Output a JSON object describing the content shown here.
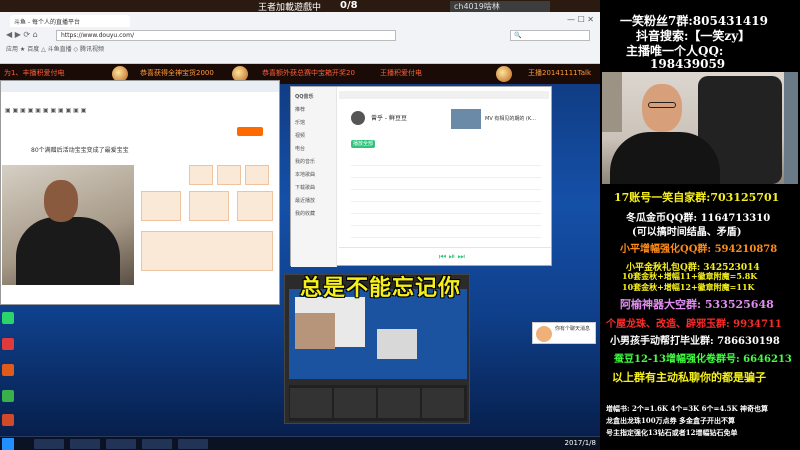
{
  "game_header": {
    "title": "王者加載遊戲中",
    "score": "0/8",
    "tab": "ch4019啥林"
  },
  "browser": {
    "tab_title": "斗鱼 - 每个人的直播平台",
    "url": "https://www.douyu.com/",
    "bookmarks": "应用  ★ 百度  △ 斗鱼直播  ◇ 腾讯视频"
  },
  "promo": {
    "items": [
      "为1、丰播积爱付电",
      "恭喜获得全神宝货2000",
      "恭喜额外获总赛中宝箱开奖20",
      "王播积爱付电",
      "王播20141111Talk"
    ]
  },
  "shop": {
    "title": "80个满赠后活动宝宝变成了最爱宝宝"
  },
  "music": {
    "brand": "QQ音乐",
    "singer": "曾乎 - 鲜豆豆",
    "mv_title": "MV 有相见的期的 (K...",
    "play_all": "播放全部",
    "sidebar": [
      "推荐",
      "乐馆",
      "视频",
      "电台",
      "我的音乐",
      "本地歌曲",
      "下载歌曲",
      "最近播放",
      "我的收藏"
    ]
  },
  "lyric": "总是不能忘记你",
  "notification": "你有个聊天消息",
  "taskbar": {
    "clock": "2017/1/8"
  },
  "info_panel": {
    "line1": "一笑粉丝7群:805431419",
    "line2": "抖音搜索:【一笑zy】",
    "line3": "主播唯一个人QQ:",
    "line4": "198439059",
    "fan17": "17账号一笑自家群:703125701",
    "ice1": "冬瓜金币QQ群: 1164713310",
    "ice2": "(可以搞时间结晶、矛盾)",
    "small": "小平增幅强化QQ群: 594210878",
    "gold1": "小平金秋礼包Q群: 342523014",
    "gold2": "10套金秋+增幅11+徽章附魔=5.8K",
    "gold3": "10套金秋+增幅12+徽章附魔=11K",
    "ayu": "阿榆神器大空群: 533525648",
    "geya": "个屋龙珠、改造、辟邪玉群: 9934711",
    "boy": "小男孩手动帮打毕业群: 786630198",
    "dou": "蚕豆12-13增幅强化卷群号: 6646213",
    "warn": "以上群有主动私聊你的都是骗子",
    "foot1": "增幅书: 2个=1.6K 4个=3K 6个=4.5K 神奇也算",
    "foot2": "龙盒出龙珠100万点券 多金盒子开出不算",
    "foot3": "号主指定强化13钻石或者12增幅钻石免单"
  },
  "colors": {
    "yellow": "#f6f01a",
    "white": "#ffffff",
    "orange": "#ff8c1a",
    "red": "#ff2a2a",
    "purple": "#e08cf0",
    "green": "#40ff40"
  }
}
